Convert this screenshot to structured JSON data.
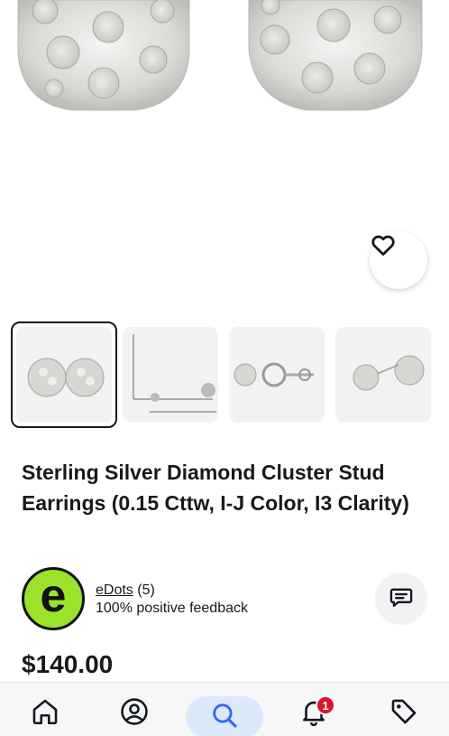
{
  "listing": {
    "title": "Sterling Silver Diamond Cluster Stud Earrings (0.15 Cttw, I-J Color, I3 Clarity)",
    "price": "$140.00"
  },
  "gallery": {
    "favorite_icon": "heart-icon",
    "thumbnails": [
      {
        "label": "stud-earrings-front",
        "selected": true
      },
      {
        "label": "size-chart",
        "selected": false
      },
      {
        "label": "earrings-front-back",
        "selected": false
      },
      {
        "label": "earrings-side",
        "selected": false
      }
    ]
  },
  "seller": {
    "logo_letter": "e",
    "name": "eDots",
    "count": "(5)",
    "feedback": "100% positive feedback",
    "logo_color": "#9be22a"
  },
  "bottom_nav": {
    "items": [
      {
        "name": "home",
        "icon": "home-icon"
      },
      {
        "name": "account",
        "icon": "user-icon"
      },
      {
        "name": "search",
        "icon": "search-icon",
        "active": true
      },
      {
        "name": "notifications",
        "icon": "bell-icon",
        "badge": "1"
      },
      {
        "name": "selling",
        "icon": "tag-icon"
      }
    ]
  },
  "colors": {
    "accent_blue": "#3665f3",
    "active_pill": "#dce9fb",
    "badge_red": "#e0102a"
  }
}
